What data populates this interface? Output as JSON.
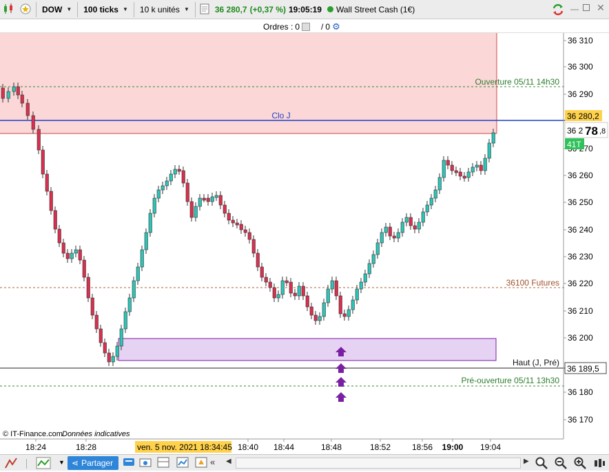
{
  "toolbar": {
    "symbol": "DOW",
    "interval": "100 ticks",
    "quantity": "10 k unités",
    "last_price": "36 280,7",
    "change": "(+0,37 %)",
    "time": "19:05:19",
    "instrument": "Wall Street Cash (1€)"
  },
  "orders": {
    "label": "Ordres :",
    "buy_count": "0",
    "sep": "/",
    "sell_count": "0"
  },
  "chart": {
    "price_axis": [
      "36 310",
      "36 300",
      "36 290",
      "36 270",
      "36 260",
      "36 250",
      "36 240",
      "36 230",
      "36 220",
      "36 210",
      "36 200",
      "36 180",
      "36 170"
    ],
    "time_axis": [
      "18:24",
      "18:28",
      "18:40",
      "18:44",
      "18:48",
      "18:52",
      "18:56",
      "19:00",
      "19:04"
    ],
    "cursor_date": "ven. 5 nov. 2021 18:34:45",
    "lines": {
      "ouverture": "Ouverture 05/11 14h30",
      "clo": "Clo J",
      "futures": "36100 Futures",
      "haut": "Haut (J, Pré)",
      "pre_ouverture": "Pré-ouverture 05/11 13h30"
    },
    "current_price_tag": "36 280,2",
    "bid_tag_prefix": "36 2",
    "bid_tag_big": "78",
    "bid_tag_small": ",8",
    "ticks_tag": "41T",
    "haut_price_tag": "36 189,5",
    "source": "© IT-Finance.com",
    "source_note": "Données indicatives"
  },
  "bottom": {
    "share_label": "Partager"
  },
  "colors": {
    "up": "#2ec4b6",
    "down": "#d9304f",
    "red_zone": "#fbd7d7",
    "purple_zone": "#e6d3f3",
    "blue_line": "#1f3fc4"
  }
}
